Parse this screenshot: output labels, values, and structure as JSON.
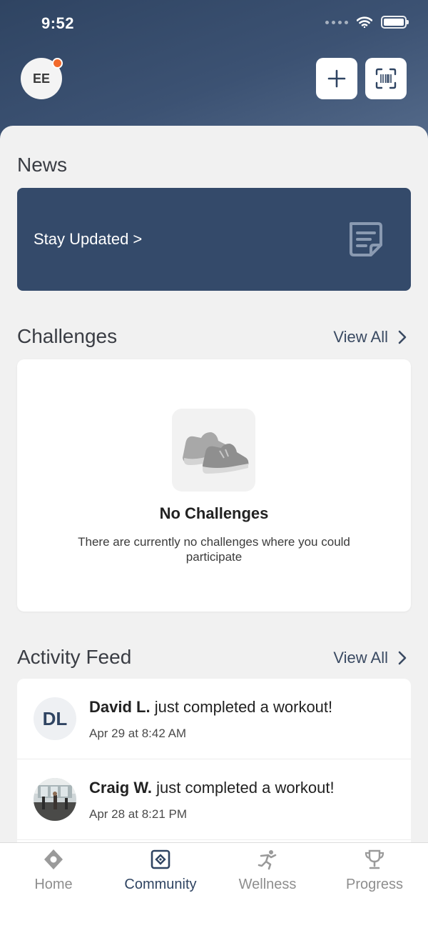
{
  "status_bar": {
    "time": "9:52"
  },
  "header": {
    "avatar_initials": "EE"
  },
  "news": {
    "title": "News",
    "card_text": "Stay Updated >"
  },
  "challenges": {
    "title": "Challenges",
    "view_all": "View All",
    "empty_title": "No Challenges",
    "empty_desc": "There are currently no challenges where you could participate"
  },
  "activity_feed": {
    "title": "Activity Feed",
    "view_all": "View All",
    "items": [
      {
        "initials": "DL",
        "name": "David L.",
        "action": " just completed a workout!",
        "time": "Apr 29 at 8:42 AM"
      },
      {
        "initials": "",
        "name": "Craig W.",
        "action": " just completed a workout!",
        "time": "Apr 28 at 8:21 PM"
      }
    ]
  },
  "tabbar": {
    "tabs": [
      {
        "label": "Home",
        "icon": "home-icon"
      },
      {
        "label": "Community",
        "icon": "community-icon"
      },
      {
        "label": "Wellness",
        "icon": "wellness-icon"
      },
      {
        "label": "Progress",
        "icon": "trophy-icon"
      }
    ],
    "active": "Community"
  },
  "colors": {
    "header": "#344a6a",
    "accent": "#2f4462",
    "notification": "#f26a2c",
    "background": "#f1f1f1"
  }
}
